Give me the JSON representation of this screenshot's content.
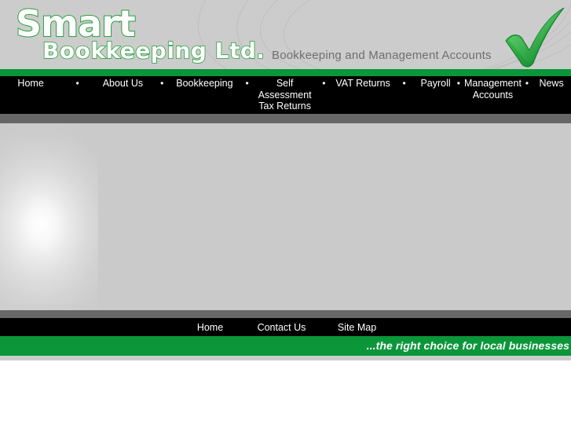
{
  "site": {
    "logo_line1": "Smart",
    "logo_line2": "Bookkeeping Ltd.",
    "tagline": "Bookkeeping and Management Accounts",
    "check_icon": "green-check-icon"
  },
  "nav": {
    "separator": "•",
    "items": [
      {
        "label": "Home"
      },
      {
        "label": "About Us"
      },
      {
        "label": "Bookkeeping"
      },
      {
        "label": "Self\nAssessment\nTax Returns"
      },
      {
        "label": "VAT Returns"
      },
      {
        "label": "Payroll"
      },
      {
        "label": "Management\nAccounts"
      },
      {
        "label": "News"
      }
    ]
  },
  "footer": {
    "links": [
      {
        "label": "Home"
      },
      {
        "label": "Contact Us"
      },
      {
        "label": "Site Map"
      }
    ],
    "slogan": "...the right choice for local businesses"
  },
  "colors": {
    "brand_green": "#0a9639",
    "logo_outline_green": "#23a03a",
    "nav_background": "#000000",
    "header_background": "#cccccc",
    "content_background": "#cacaca",
    "divider_grey": "#676767",
    "tagline_grey": "#6e6e6e"
  }
}
